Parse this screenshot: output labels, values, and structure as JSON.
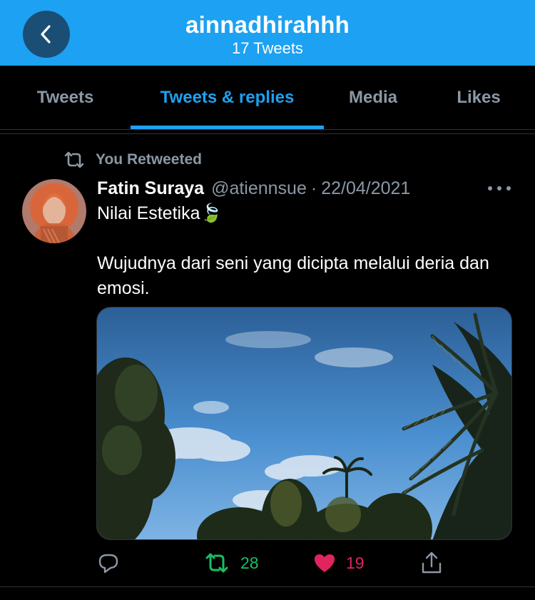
{
  "header": {
    "title": "ainnadhirahhh",
    "subtitle": "17 Tweets",
    "back_icon": "chevron-left-icon"
  },
  "tabs": [
    {
      "label": "Tweets",
      "active": false
    },
    {
      "label": "Tweets & replies",
      "active": true
    },
    {
      "label": "Media",
      "active": false
    },
    {
      "label": "Likes",
      "active": false
    }
  ],
  "tweet": {
    "retweet_note": "You Retweeted",
    "author_name": "Fatin Suraya",
    "handle": "@atiennsue",
    "separator": "·",
    "date": "22/04/2021",
    "text_line1": "Nilai Estetika🍃",
    "text_line2": "Wujudnya dari seni yang dicipta melalui deria dan emosi.",
    "media_alt": "Photo of blue sky with clouds, coconut palms and trees",
    "reply_count": "",
    "retweet_count": "28",
    "like_count": "19"
  },
  "colors": {
    "accent": "#1da1f2",
    "retweet": "#17bf63",
    "like": "#e0245e",
    "muted": "#8b98a5"
  }
}
